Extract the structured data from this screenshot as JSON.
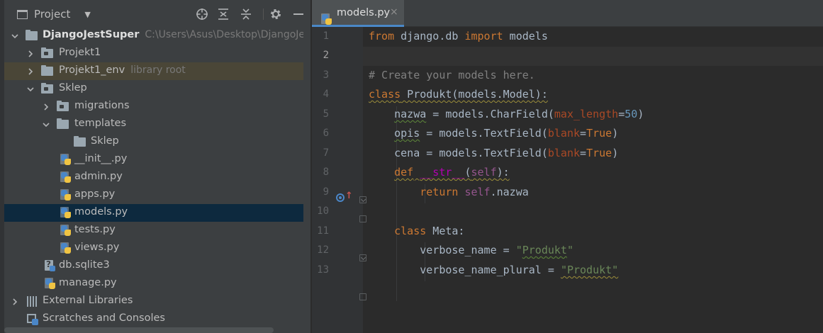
{
  "project_panel": {
    "title": "Project",
    "caret": "▼",
    "toolbar_icons": [
      "locate-icon",
      "expand-all-icon",
      "collapse-all-icon",
      "gear-icon",
      "minimize-icon"
    ],
    "tree": [
      {
        "label": "DjangoJestSuper",
        "hint": "C:\\Users\\Asus\\Desktop\\DjangoJestSuper",
        "type": "folder",
        "expanded": true
      },
      {
        "label": "Projekt1",
        "type": "folder",
        "expanded": false
      },
      {
        "label": "Projekt1_env",
        "hint": "library root",
        "type": "folder",
        "expanded": false
      },
      {
        "label": "Sklep",
        "type": "folder",
        "expanded": true
      },
      {
        "label": "migrations",
        "type": "folder",
        "expanded": false
      },
      {
        "label": "templates",
        "type": "folder",
        "expanded": true
      },
      {
        "label": "Sklep",
        "type": "folder"
      },
      {
        "label": "__init__.py",
        "type": "python-file"
      },
      {
        "label": "admin.py",
        "type": "python-file"
      },
      {
        "label": "apps.py",
        "type": "python-file"
      },
      {
        "label": "models.py",
        "type": "python-file",
        "selected": true
      },
      {
        "label": "tests.py",
        "type": "python-file"
      },
      {
        "label": "views.py",
        "type": "python-file"
      },
      {
        "label": "db.sqlite3",
        "type": "database-file"
      },
      {
        "label": "manage.py",
        "type": "python-file"
      },
      {
        "label": "External Libraries",
        "type": "libraries",
        "expanded": false
      },
      {
        "label": "Scratches and Consoles",
        "type": "scratches"
      }
    ]
  },
  "editor": {
    "tab": {
      "label": "models.py",
      "close": "×"
    },
    "line_numbers": [
      "1",
      "2",
      "3",
      "4",
      "5",
      "6",
      "7",
      "8",
      "9",
      "10",
      "11",
      "12",
      "13"
    ],
    "current_line": "2",
    "code": {
      "l1": {
        "kw1": "from",
        "t1": " django.db ",
        "kw2": "import",
        "t2": " models"
      },
      "l3": {
        "c": "# Create your models here."
      },
      "l4": {
        "kw": "class",
        "t1": " Produkt(models.Model):"
      },
      "l5": {
        "t1": "    ",
        "v": "nazwa",
        "t2": " = models.CharField(",
        "p": "max_length",
        "t3": "=",
        "n": "50",
        "t4": ")"
      },
      "l6": {
        "t1": "    ",
        "v": "opis",
        "t2": " = models.TextField(",
        "p": "blank",
        "t3": "=",
        "k": "True",
        "t4": ")"
      },
      "l7": {
        "t1": "    ",
        "v": "cena",
        "t2": " = models.TextField(",
        "p": "blank",
        "t3": "=",
        "k": "True",
        "t4": ")"
      },
      "l8": {
        "t1": "    ",
        "kw": "def",
        "t2": " ",
        "m": "__str__",
        "t3": "(",
        "s": "self",
        "t4": "):"
      },
      "l9": {
        "t1": "        ",
        "kw": "return",
        "t2": " ",
        "s": "self",
        "t3": ".nazwa"
      },
      "l11": {
        "t1": "    ",
        "kw": "class",
        "t2": " Meta:"
      },
      "l12": {
        "t1": "        verbose_name = ",
        "q1": "\"",
        "sv": "Produkt",
        "q2": "\""
      },
      "l13": {
        "t1": "        verbose_name_plural = ",
        "sv": "\"Produkt\""
      }
    }
  },
  "colors": {
    "keyword": "#cc7832",
    "comment": "#808080",
    "string": "#6a8759",
    "number": "#6897bb",
    "param": "#aa4926",
    "self": "#94558d",
    "dunder": "#b200b2",
    "selection": "#0d293e",
    "library_root": "#4a4637",
    "tab_accent": "#4a88c7"
  }
}
